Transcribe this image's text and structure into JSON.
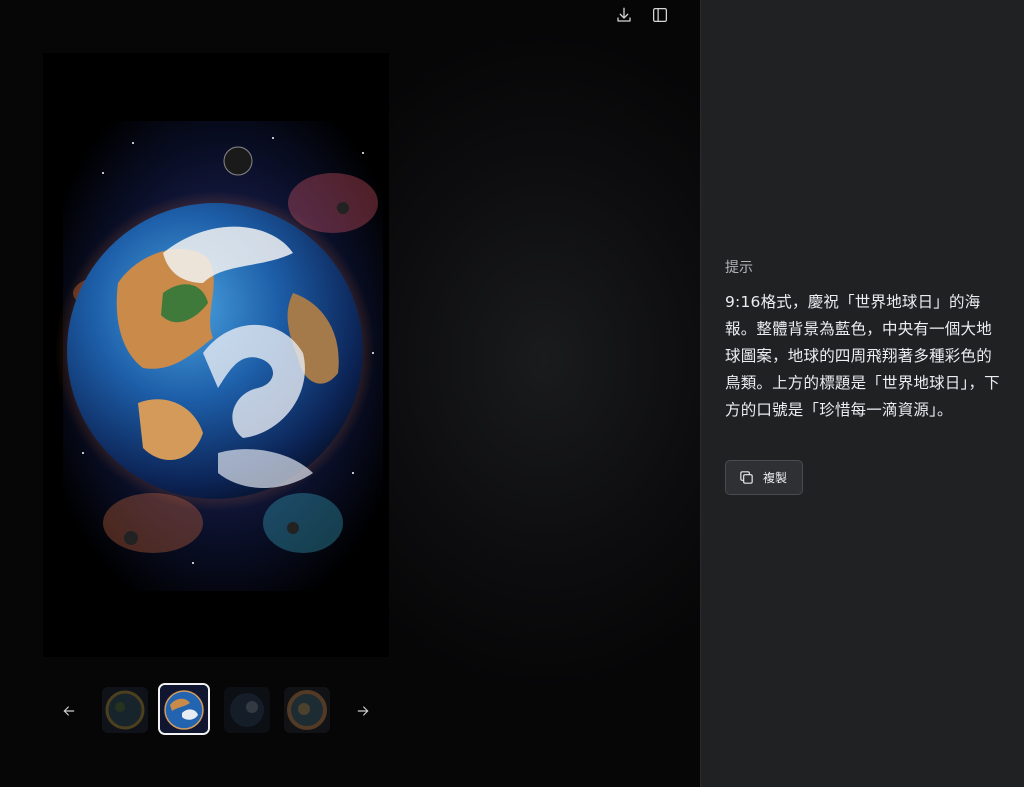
{
  "toolbar": {
    "download_icon": "download-icon",
    "sidebar_toggle_icon": "sidebar-toggle-icon"
  },
  "gallery": {
    "prev_icon": "arrow-left-icon",
    "next_icon": "arrow-right-icon",
    "selected_index": 2,
    "thumbnail_count": 4
  },
  "side_panel": {
    "heading": "提示",
    "prompt": "9:16格式，慶祝「世界地球日」的海報。整體背景為藍色，中央有一個大地球圖案，地球的四周飛翔著多種彩色的鳥類。上方的標題是「世界地球日」，下方的口號是「珍惜每一滴資源」。",
    "copy_label": "複製",
    "copy_icon": "copy-icon"
  },
  "colors": {
    "panel_bg": "#202123",
    "viewer_bg": "#0b0b0c",
    "text": "#ececf1",
    "muted": "#b4b4b8"
  }
}
